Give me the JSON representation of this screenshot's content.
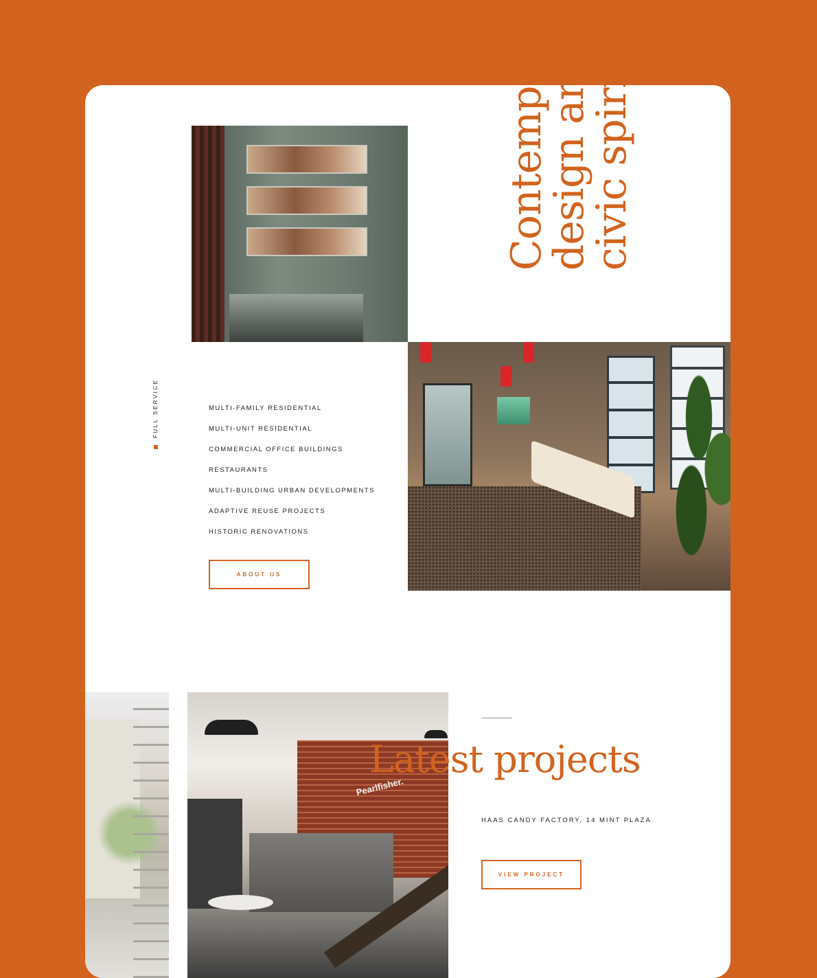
{
  "hero": {
    "headline_lines": [
      "Contempo",
      "design and",
      "civic spirit"
    ]
  },
  "services": {
    "label": "FULL SERVICE",
    "items": [
      "MULTI-FAMILY RESIDENTIAL",
      "MULTI-UNIT RESIDENTIAL",
      "COMMERCIAL OFFICE BUILDINGS",
      "RESTAURANTS",
      "MULTI-BUILDING URBAN DEVELOPMENTS",
      "ADAPTIVE REUSE PROJECTS",
      "HISTORIC RENOVATIONS"
    ],
    "about_button": "ABOUT US"
  },
  "latest": {
    "title": "Latest projects",
    "project_name": "HAAS CANDY FACTORY, 14 MINT PLAZA",
    "view_button": "VIEW PROJECT",
    "sign_text": "Pearlfisher."
  },
  "colors": {
    "accent": "#d2631e",
    "background": "#d2631e",
    "card": "#ffffff"
  }
}
